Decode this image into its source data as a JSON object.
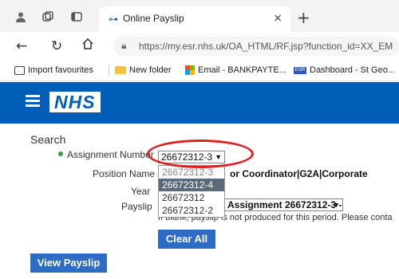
{
  "browser": {
    "tab_title": "Online Payslip",
    "url_host": "https://my.esr.nhs.uk",
    "url_path": "/OA_HTML/RF.jsp?function_id=XX_EM",
    "favourites": [
      "Import favourites",
      "New folder",
      "Email - BANKPAYTE...",
      "Dashboard - St Geo..."
    ],
    "dashboard_icon_text": "ESR"
  },
  "header": {
    "logo": "NHS"
  },
  "search": {
    "title": "Search",
    "assignment_label": "Assignment Number",
    "assignment_value": "26672312-3",
    "position_label": "Position Name",
    "position_value": "or Coordinator|G2A|Corporate",
    "year_label": "Year",
    "payslip_label": "Payslip",
    "payslip_value": "Assignment 26672312-3 -",
    "note": "If blank, payslip is not produced for this period. Please conta",
    "dropdown_options": [
      "26672312-3",
      "26672312-4",
      "26672312",
      "26672312-2"
    ],
    "clear_label": "Clear All",
    "view_label": "View Payslip"
  },
  "colors": {
    "nhs_blue": "#005eb8",
    "button_blue": "#2e6bc4",
    "highlight_red": "#e02020"
  }
}
